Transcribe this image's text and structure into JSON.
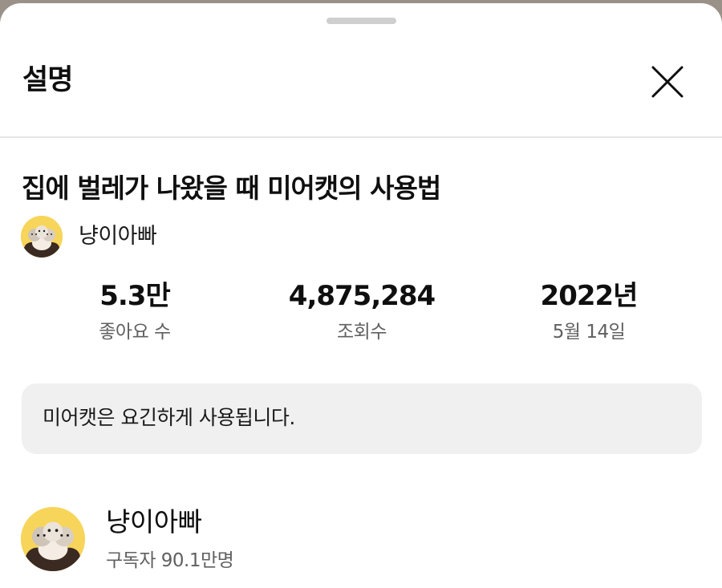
{
  "sheet": {
    "title": "설명",
    "close_icon": "close-icon"
  },
  "video": {
    "title": "집에 벌레가 나왔을 때 미어캣의 사용법",
    "channel_name": "냥이아빠"
  },
  "stats": {
    "likes": {
      "value": "5.3만",
      "label": "좋아요 수"
    },
    "views": {
      "value": "4,875,284",
      "label": "조회수"
    },
    "date": {
      "value": "2022년",
      "label": "5월 14일"
    }
  },
  "description": {
    "text": "미어캣은 요긴하게 사용됩니다."
  },
  "channel": {
    "name": "냥이아빠",
    "subscribers": "구독자 90.1만명",
    "avatar_icon": "avatar-image"
  },
  "colors": {
    "sheet_background": "#ffffff",
    "description_background": "#f0f0f0",
    "avatar_background": "#f7d55a",
    "secondary_text": "#606060"
  }
}
